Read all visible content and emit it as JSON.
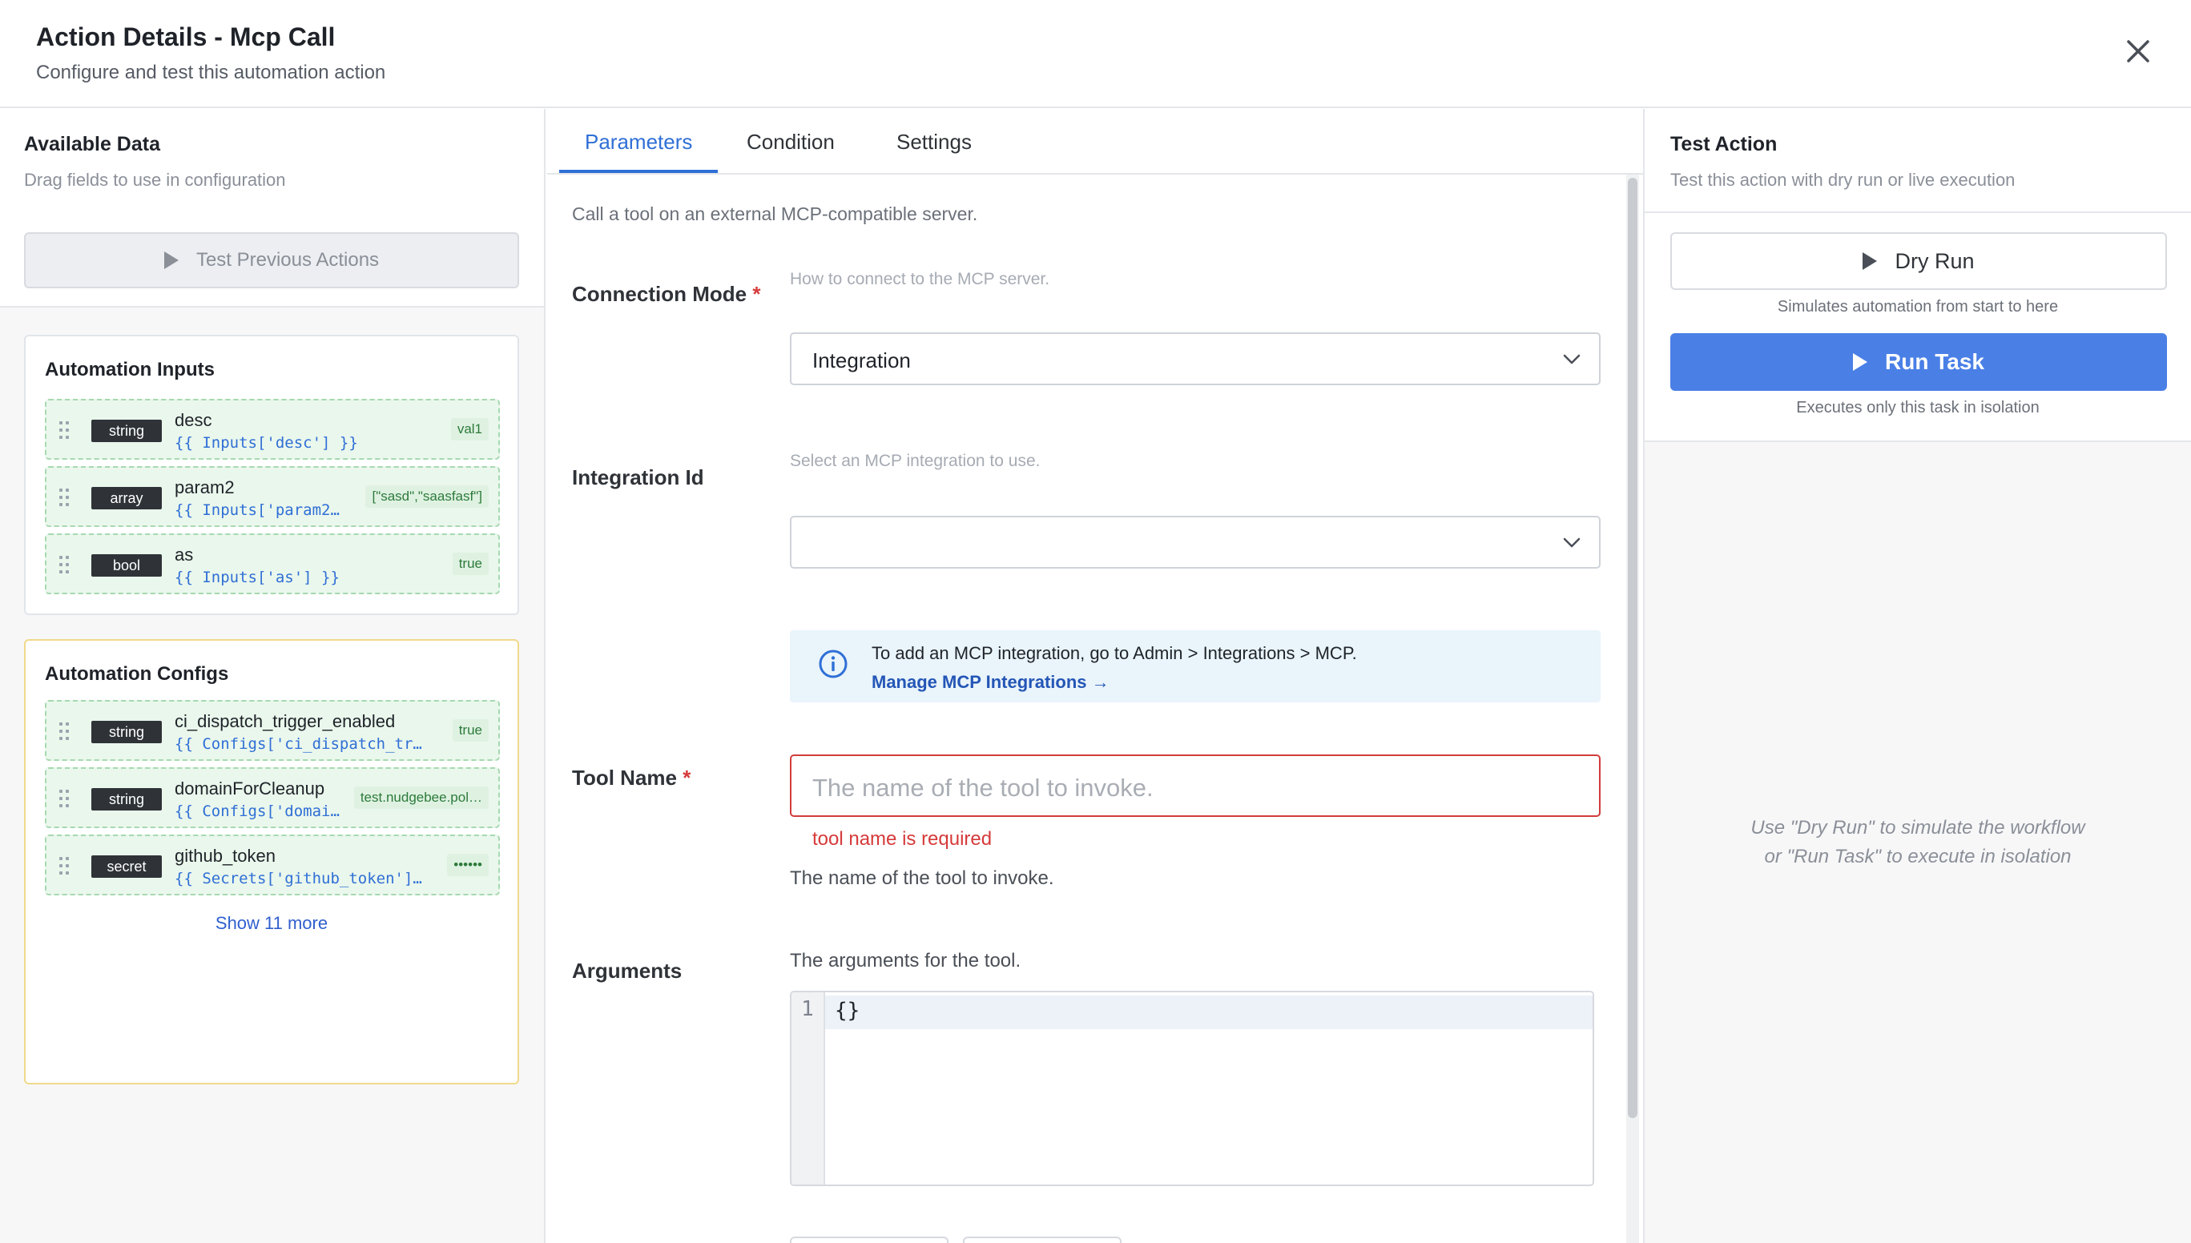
{
  "header": {
    "title": "Action Details - Mcp Call",
    "subtitle": "Configure and test this automation action"
  },
  "left_panel": {
    "title": "Available Data",
    "subtitle": "Drag fields to use in configuration",
    "test_previous_label": "Test Previous Actions",
    "inputs_card": {
      "title": "Automation Inputs",
      "items": [
        {
          "type": "string",
          "name": "desc",
          "expr": "{{ Inputs['desc'] }}",
          "value": "val1"
        },
        {
          "type": "array",
          "name": "param2",
          "expr": "{{ Inputs['param2'…",
          "value": "[\"sasd\",\"saasfasf\"]"
        },
        {
          "type": "bool",
          "name": "as",
          "expr": "{{ Inputs['as'] }}",
          "value": "true"
        }
      ]
    },
    "configs_card": {
      "title": "Automation Configs",
      "items": [
        {
          "type": "string",
          "name": "ci_dispatch_trigger_enabled",
          "expr": "{{ Configs['ci_dispatch_trigg…",
          "value": "true"
        },
        {
          "type": "string",
          "name": "domainForCleanup",
          "expr": "{{ Configs['domai…",
          "value": "test.nudgebee.pol…"
        },
        {
          "type": "secret",
          "name": "github_token",
          "expr": "{{ Secrets['github_token'] }}",
          "value": "••••••"
        }
      ],
      "show_more_label": "Show 11 more"
    }
  },
  "center": {
    "tabs": [
      "Parameters",
      "Condition",
      "Settings"
    ],
    "active_tab": "Parameters",
    "description": "Call a tool on an external MCP-compatible server.",
    "connection_mode": {
      "label": "Connection Mode",
      "required_mark": "*",
      "hint": "How to connect to the MCP server.",
      "value": "Integration"
    },
    "integration_id": {
      "label": "Integration Id",
      "hint": "Select an MCP integration to use.",
      "value": ""
    },
    "info": {
      "text": "To add an MCP integration, go to Admin > Integrations > MCP.",
      "link": "Manage MCP Integrations →"
    },
    "tool_name": {
      "label": "Tool Name",
      "required_mark": "*",
      "placeholder": "The name of the tool to invoke.",
      "error": "tool name is required",
      "help": "The name of the tool to invoke."
    },
    "arguments": {
      "label": "Arguments",
      "help": "The arguments for the tool.",
      "line_number": "1",
      "code": "{}"
    }
  },
  "right_panel": {
    "title": "Test Action",
    "subtitle": "Test this action with dry run or live execution",
    "dry_run_label": "Dry Run",
    "dry_run_caption": "Simulates automation from start to here",
    "run_task_label": "Run Task",
    "run_task_caption": "Executes only this task in isolation",
    "empty_line1": "Use \"Dry Run\" to simulate the workflow",
    "empty_line2": "or \"Run Task\" to execute in isolation"
  },
  "colors": {
    "accent": "#2f6fd6",
    "primary_button": "#4a7fe6",
    "error": "#d63a3a",
    "field_bg": "#eaf7ec",
    "configs_border": "#f0d98a"
  }
}
